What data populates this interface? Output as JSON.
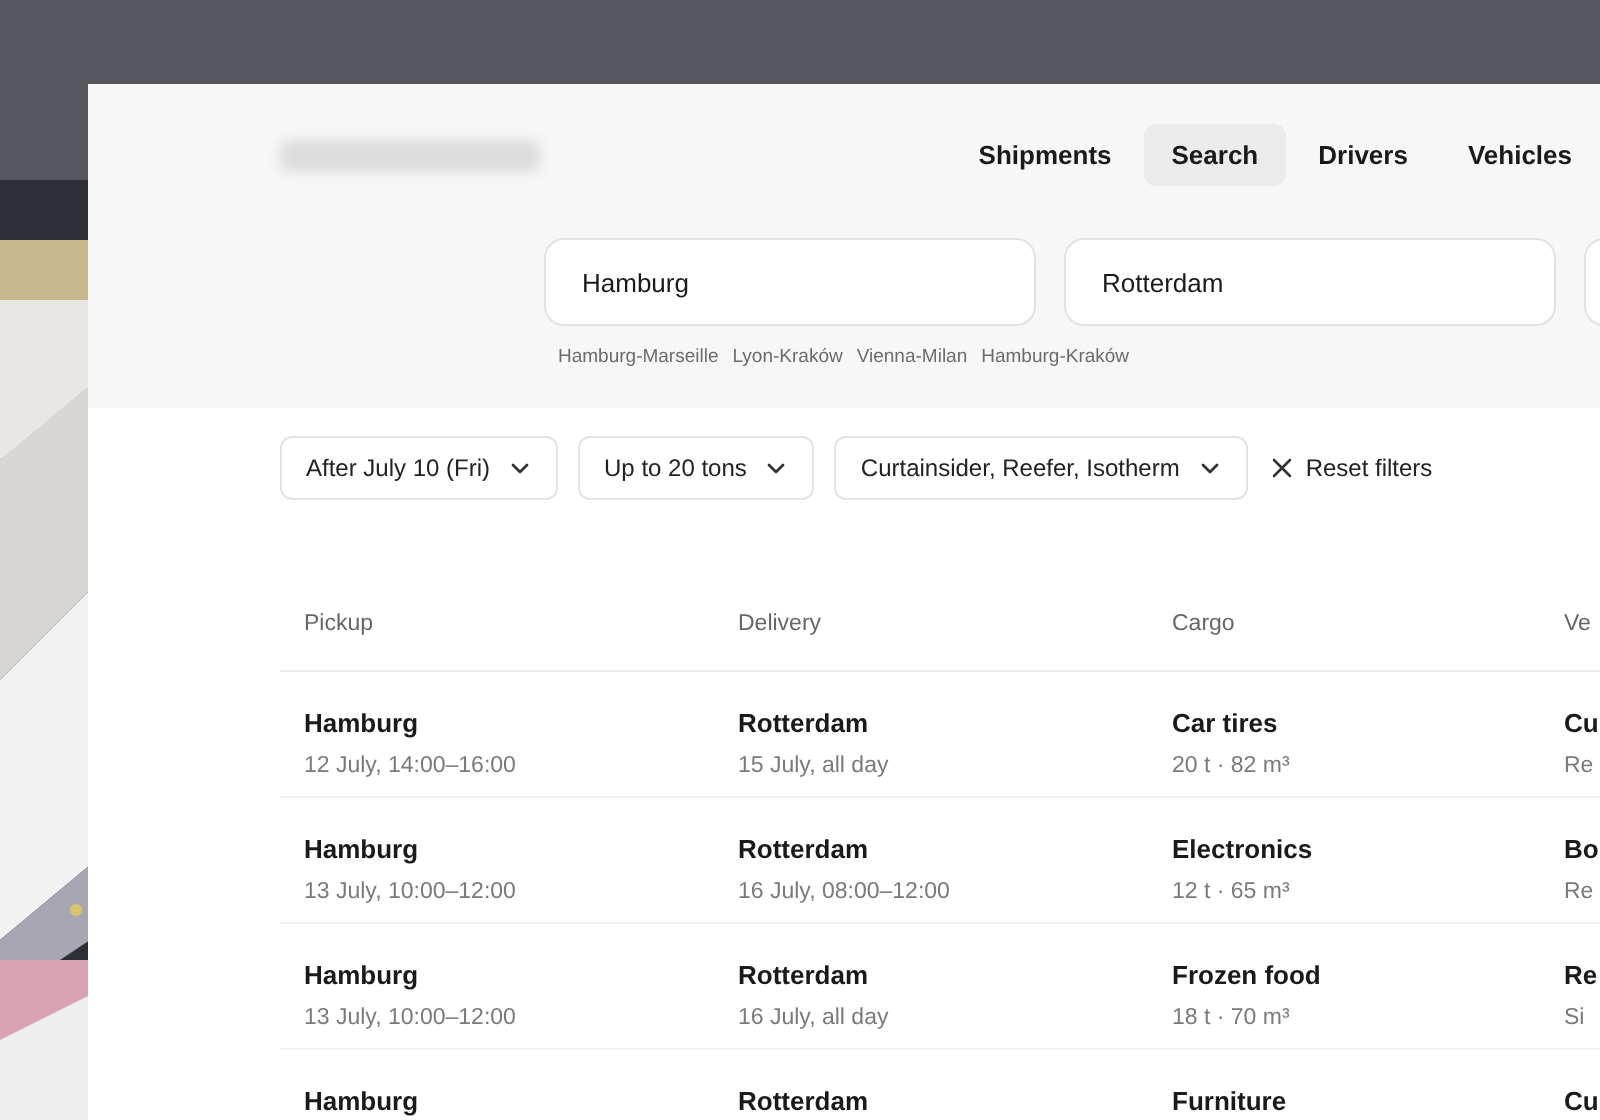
{
  "nav": [
    {
      "label": "Shipments",
      "selected": false
    },
    {
      "label": "Search",
      "selected": true
    },
    {
      "label": "Drivers",
      "selected": false
    },
    {
      "label": "Vehicles",
      "selected": false
    }
  ],
  "search": {
    "fields": [
      {
        "value": "Hamburg"
      },
      {
        "value": "Rotterdam"
      }
    ],
    "suggestions": [
      "Hamburg-Marseille",
      "Lyon-Kraków",
      "Vienna-Milan",
      "Hamburg-Kraków"
    ]
  },
  "filters": [
    {
      "label": "After July 10 (Fri)"
    },
    {
      "label": "Up to 20 tons"
    },
    {
      "label": "Curtainsider, Reefer, Isotherm"
    }
  ],
  "reset": {
    "label": "Reset filters"
  },
  "table": {
    "columns": [
      "Pickup",
      "Delivery",
      "Cargo",
      "Ve"
    ],
    "rows": [
      {
        "cells": [
          {
            "main": "Hamburg",
            "sub": "12 July, 14:00–16:00"
          },
          {
            "main": "Rotterdam",
            "sub": "15 July, all day"
          },
          {
            "main": "Car tires",
            "sub": "20 t · 82 m³"
          },
          {
            "main": "Cu",
            "sub": "Re"
          }
        ]
      },
      {
        "cells": [
          {
            "main": "Hamburg",
            "sub": "13 July, 10:00–12:00"
          },
          {
            "main": "Rotterdam",
            "sub": "16 July, 08:00–12:00"
          },
          {
            "main": "Electronics",
            "sub": "12 t · 65 m³"
          },
          {
            "main": "Bo",
            "sub": "Re"
          }
        ]
      },
      {
        "cells": [
          {
            "main": "Hamburg",
            "sub": "13 July, 10:00–12:00"
          },
          {
            "main": "Rotterdam",
            "sub": "16 July, all day"
          },
          {
            "main": "Frozen food",
            "sub": "18 t · 70 m³"
          },
          {
            "main": "Re",
            "sub": "Si"
          }
        ]
      },
      {
        "cells": [
          {
            "main": "Hamburg"
          },
          {
            "main": "Rotterdam"
          },
          {
            "main": "Furniture"
          },
          {
            "main": "Cu"
          }
        ]
      }
    ]
  }
}
